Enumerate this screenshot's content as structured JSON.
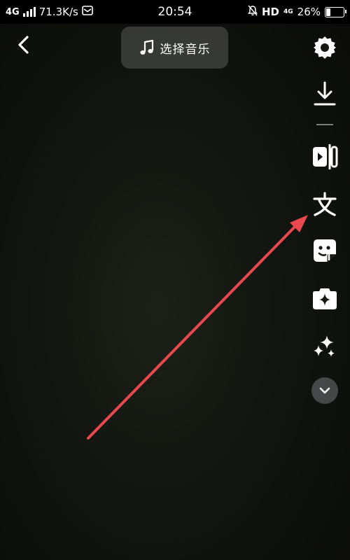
{
  "status_bar": {
    "network": "4G",
    "speed": "71.3K/s",
    "time": "20:54",
    "hd": "HD",
    "net_4g": "4G",
    "battery": "26%",
    "battery_level": 0.26
  },
  "top": {
    "music_label": "选择音乐"
  },
  "toolbar": {
    "items": [
      {
        "icon": "settings-icon"
      },
      {
        "icon": "download-icon"
      },
      {
        "icon": "video-edit-icon"
      },
      {
        "icon": "text-icon"
      },
      {
        "icon": "sticker-icon"
      },
      {
        "icon": "effects-icon"
      },
      {
        "icon": "sparkle-icon"
      },
      {
        "icon": "chevron-down-icon"
      }
    ]
  },
  "colors": {
    "annotation": "#e8484e",
    "pill_bg": "#464846"
  }
}
